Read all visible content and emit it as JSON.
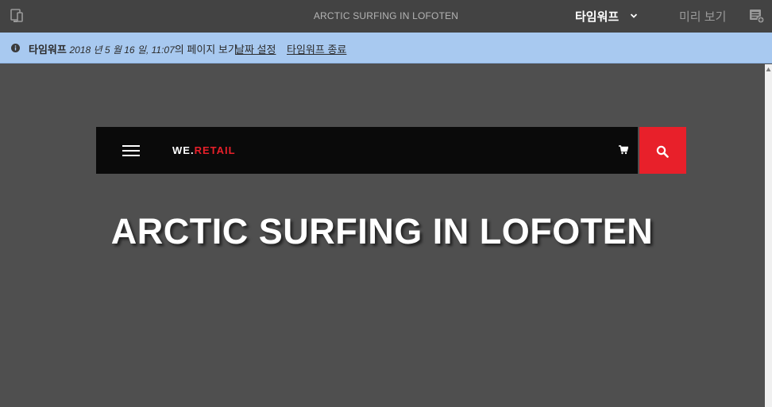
{
  "toolbar": {
    "title": "ARCTIC SURFING IN LOFOTEN",
    "mode_label": "타임워프",
    "preview_label": "미리 보기",
    "icons": {
      "device": "device-preview-icon",
      "mode_chevron": "chevron-down-icon",
      "annotation": "annotation-icon"
    }
  },
  "banner": {
    "mode_name": "타임워프",
    "date": "2018 년 5 월 16 일, 11:07",
    "suffix": "의 페이지 보기",
    "set_date_link": "날짜 설정",
    "exit_link": "타임워프 종료",
    "icon": "info-icon"
  },
  "site": {
    "logo_we": "WE.",
    "logo_retail": "RETAIL",
    "hero_title": "ARCTIC SURFING IN LOFOTEN",
    "icons": {
      "menu": "hamburger-menu-icon",
      "cart": "cart-icon",
      "search": "search-icon"
    }
  },
  "colors": {
    "toolbar_bg": "#434343",
    "banner_bg": "#a8c9f0",
    "canvas_bg": "#4f4f4f",
    "nav_bg": "#0a0a0a",
    "accent_red": "#e8202a"
  }
}
